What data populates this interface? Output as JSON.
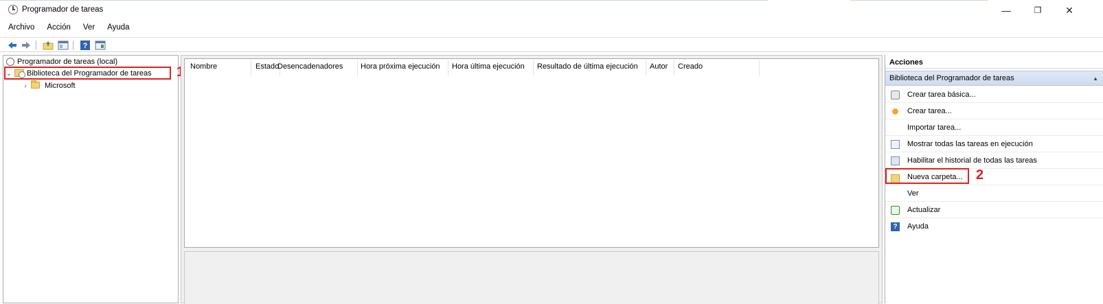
{
  "window": {
    "title": "Programador de tareas",
    "controls": {
      "minimize": "—",
      "restore": "❐",
      "close": "✕"
    }
  },
  "menu": [
    "Archivo",
    "Acción",
    "Ver",
    "Ayuda"
  ],
  "toolbar": {
    "icons": [
      "back-arrow-icon",
      "forward-arrow-icon",
      "folder-up-icon",
      "console-tree-icon",
      "help-icon",
      "show-pane-icon"
    ]
  },
  "tree": {
    "root": "Programador de tareas (local)",
    "library": "Biblioteca del Programador de tareas",
    "children": [
      "Microsoft"
    ]
  },
  "table": {
    "columns": [
      "Nombre",
      "Estado",
      "Desencadenadores",
      "Hora próxima ejecución",
      "Hora última ejecución",
      "Resultado de última ejecución",
      "Autor",
      "Creado"
    ]
  },
  "actions": {
    "header": "Acciones",
    "section": "Biblioteca del Programador de tareas",
    "items": [
      {
        "label": "Crear tarea básica...",
        "icon": "basic-task-icon"
      },
      {
        "label": "Crear tarea...",
        "icon": "create-task-icon"
      },
      {
        "label": "Importar tarea...",
        "icon": ""
      },
      {
        "label": "Mostrar todas las tareas en ejecución",
        "icon": "running-tasks-icon"
      },
      {
        "label": "Habilitar el historial de todas las tareas",
        "icon": "history-icon"
      },
      {
        "label": "Nueva carpeta...",
        "icon": "folder-icon"
      },
      {
        "label": "Ver",
        "icon": ""
      },
      {
        "label": "Actualizar",
        "icon": "refresh-icon"
      },
      {
        "label": "Ayuda",
        "icon": "help-icon"
      }
    ]
  },
  "annotations": {
    "callout_1": "1",
    "callout_2": "2",
    "highlight_color": "#e02020"
  },
  "colors": {
    "selection": "#cce4f7",
    "section_header": "#dfe8f5"
  }
}
